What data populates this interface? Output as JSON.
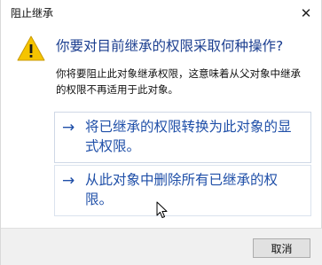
{
  "window": {
    "title": "阻止继承",
    "close_glyph": "✕"
  },
  "main": {
    "icon": "warning-triangle-icon",
    "heading": "你要对目前继承的权限采取何种操作?",
    "description_lines": [
      "你将要阻止此对象继承权限，这意味着从父对象中继承",
      "的权限不再适用于此对象。"
    ]
  },
  "options": [
    {
      "arrow": "→",
      "lines": [
        "将已继承的权限转换为此对象的显",
        "式权限。"
      ]
    },
    {
      "arrow": "→",
      "lines": [
        "从此对象中删除所有已继承的权",
        "限。"
      ]
    }
  ],
  "footer": {
    "cancel_label": "取消"
  },
  "colors": {
    "link_blue": "#1f4fa8",
    "heading_blue": "#1a3d8f",
    "warning_yellow": "#f5c400"
  }
}
